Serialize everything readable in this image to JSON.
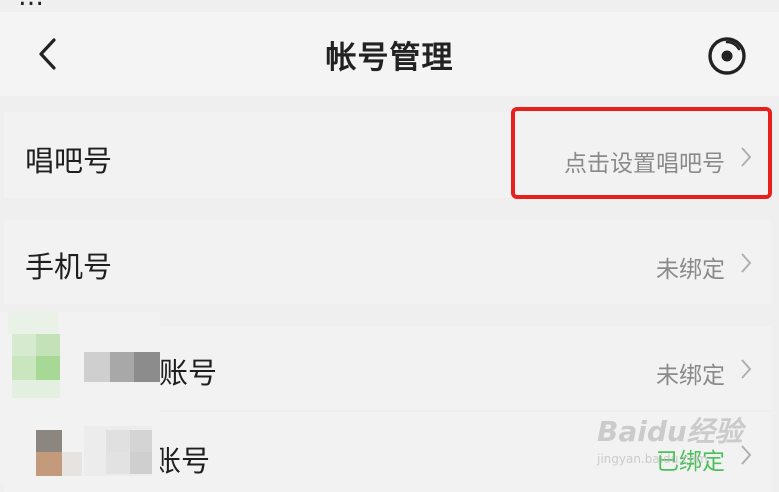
{
  "status_bar": {
    "partial_text": "…"
  },
  "header": {
    "title": "帐号管理",
    "back_icon": "chevron-left-icon",
    "record_icon": "record-disc-icon"
  },
  "rows": [
    {
      "label": "唱吧号",
      "value": "点击设置唱吧号"
    },
    {
      "label": "手机号",
      "value": "未绑定"
    },
    {
      "label": "账号",
      "value": "未绑定"
    },
    {
      "label": "账号",
      "value": "已绑定"
    }
  ],
  "colors": {
    "highlight": "#e8201c",
    "bound_green": "#4cc05a",
    "muted_text": "#8a8a8a"
  },
  "watermark": {
    "logo": "Baidu经验",
    "sub": "jingyan.baidu.com"
  }
}
